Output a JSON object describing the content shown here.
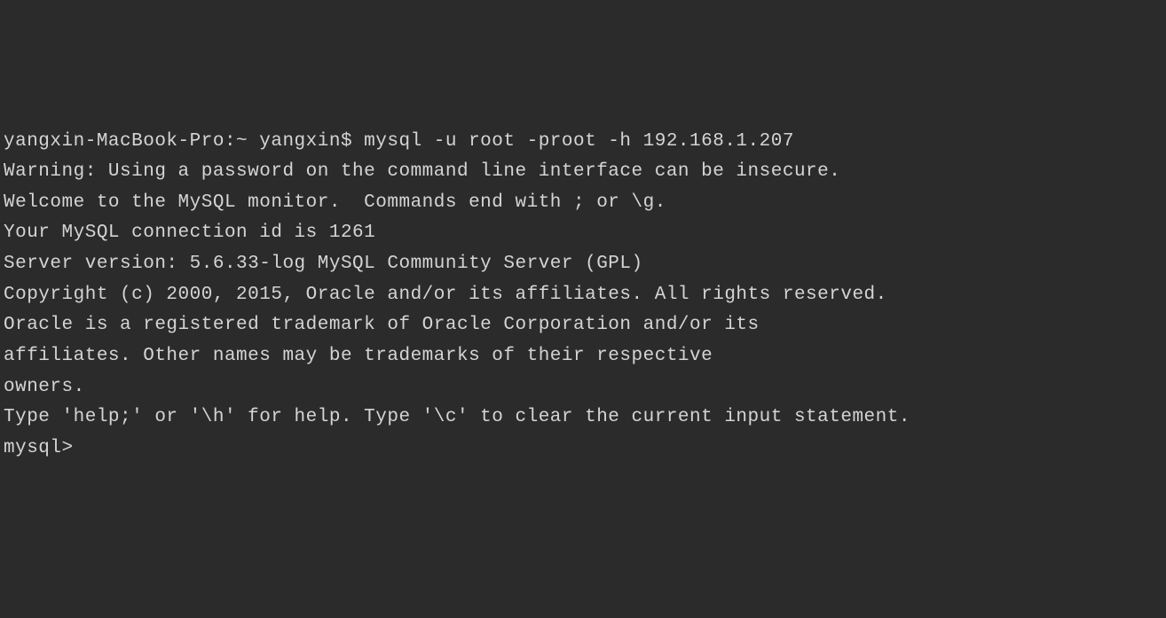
{
  "terminal": {
    "lines": [
      "yangxin-MacBook-Pro:~ yangxin$ mysql -u root -proot -h 192.168.1.207",
      "Warning: Using a password on the command line interface can be insecure.",
      "Welcome to the MySQL monitor.  Commands end with ; or \\g.",
      "Your MySQL connection id is 1261",
      "Server version: 5.6.33-log MySQL Community Server (GPL)",
      "",
      "Copyright (c) 2000, 2015, Oracle and/or its affiliates. All rights reserved.",
      "",
      "Oracle is a registered trademark of Oracle Corporation and/or its",
      "affiliates. Other names may be trademarks of their respective",
      "owners.",
      "",
      "Type 'help;' or '\\h' for help. Type '\\c' to clear the current input statement.",
      "",
      "mysql> "
    ]
  }
}
